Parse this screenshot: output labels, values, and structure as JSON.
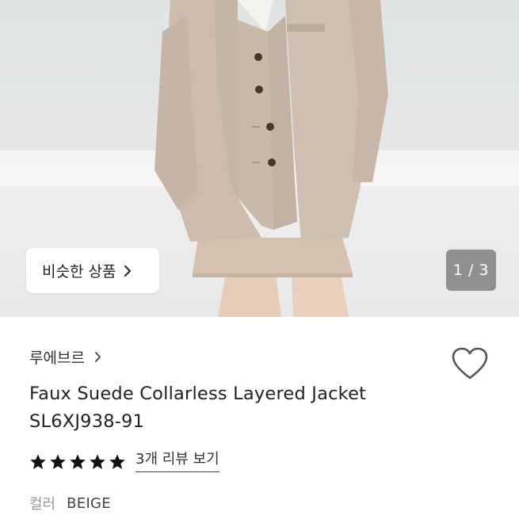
{
  "gallery": {
    "similar_label": "비슷한 상품",
    "page_indicator": "1 / 3"
  },
  "product": {
    "brand": "루에브르",
    "name_line1": "Faux Suede Collarless Layered Jacket",
    "name_line2": "SL6XJ938-91",
    "rating": 5,
    "review_link": "3개 리뷰 보기",
    "option_label": "컬러",
    "option_value": "BEIGE"
  },
  "colors": {
    "star": "#111111",
    "indicator_bg": "#6e6e6e",
    "garment": "#cbbcae"
  },
  "icons": {
    "similar_chevron": "chevron-right-icon",
    "brand_chevron": "chevron-right-icon",
    "wishlist": "heart-outline-icon",
    "star": "star-filled-icon"
  }
}
